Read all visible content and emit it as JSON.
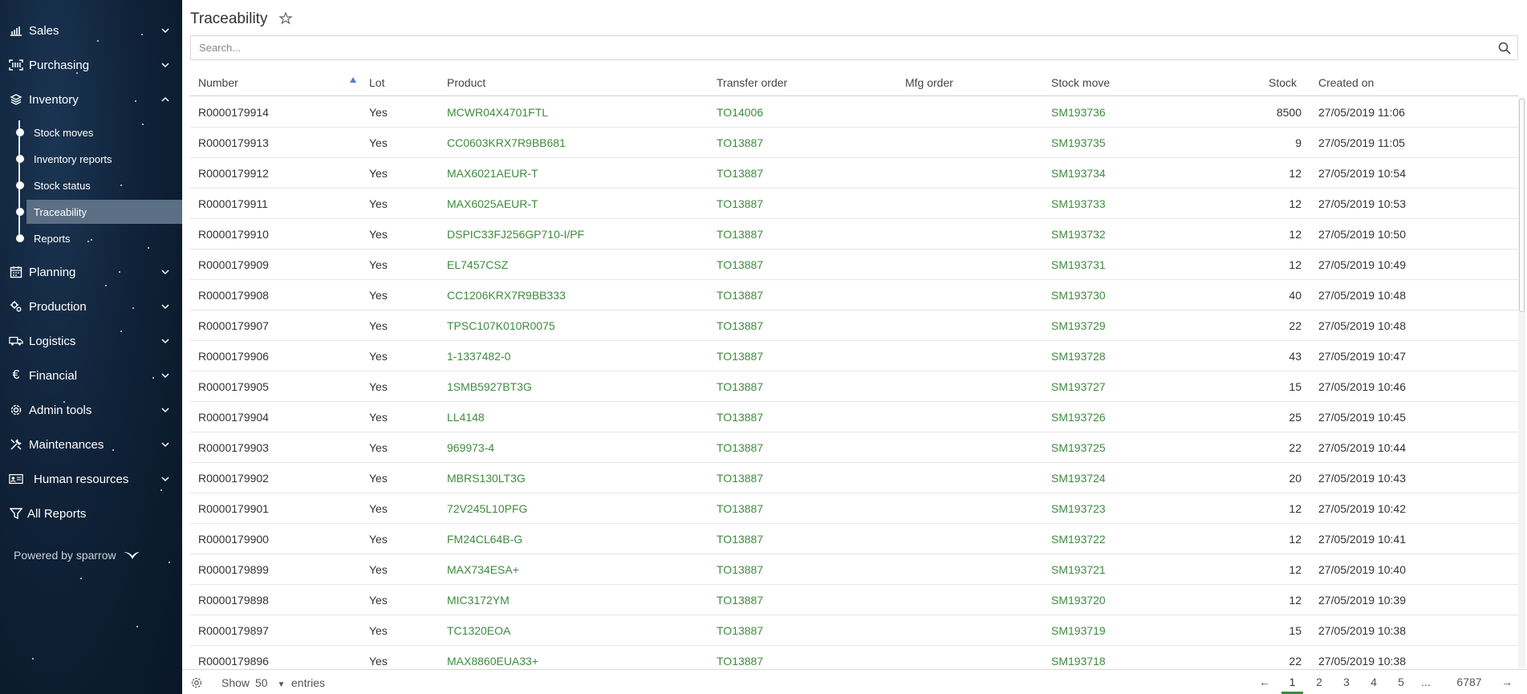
{
  "sidebar": {
    "items": [
      {
        "label": "Sales",
        "icon": "chart-icon",
        "expanded": false
      },
      {
        "label": "Purchasing",
        "icon": "scan-icon",
        "expanded": false
      },
      {
        "label": "Inventory",
        "icon": "layers-icon",
        "expanded": true
      },
      {
        "label": "Planning",
        "icon": "calendar-icon",
        "expanded": false
      },
      {
        "label": "Production",
        "icon": "cogs-icon",
        "expanded": false
      },
      {
        "label": "Logistics",
        "icon": "truck-icon",
        "expanded": false
      },
      {
        "label": "Financial",
        "icon": "euro-icon",
        "expanded": false
      },
      {
        "label": "Admin tools",
        "icon": "gear-icon",
        "expanded": false
      },
      {
        "label": "Maintenances",
        "icon": "tools-icon",
        "expanded": false
      },
      {
        "label": "Human resources",
        "icon": "id-card-icon",
        "expanded": false
      },
      {
        "label": "All Reports",
        "icon": "filter-icon"
      }
    ],
    "inventory_sub": [
      {
        "label": "Stock moves"
      },
      {
        "label": "Inventory reports"
      },
      {
        "label": "Stock status"
      },
      {
        "label": "Traceability",
        "active": true
      },
      {
        "label": "Reports"
      }
    ],
    "powered_by": "Powered by sparrow"
  },
  "page": {
    "title": "Traceability",
    "search_placeholder": "Search..."
  },
  "table": {
    "columns": [
      "Number",
      "Lot",
      "Product",
      "Transfer order",
      "Mfg order",
      "Stock move",
      "Stock",
      "Created on"
    ],
    "sort_column": "Number",
    "rows": [
      [
        "R0000179914",
        "Yes",
        "MCWR04X4701FTL",
        "TO14006",
        "",
        "SM193736",
        "8500",
        "27/05/2019 11:06"
      ],
      [
        "R0000179913",
        "Yes",
        "CC0603KRX7R9BB681",
        "TO13887",
        "",
        "SM193735",
        "9",
        "27/05/2019 11:05"
      ],
      [
        "R0000179912",
        "Yes",
        "MAX6021AEUR-T",
        "TO13887",
        "",
        "SM193734",
        "12",
        "27/05/2019 10:54"
      ],
      [
        "R0000179911",
        "Yes",
        "MAX6025AEUR-T",
        "TO13887",
        "",
        "SM193733",
        "12",
        "27/05/2019 10:53"
      ],
      [
        "R0000179910",
        "Yes",
        "DSPIC33FJ256GP710-I/PF",
        "TO13887",
        "",
        "SM193732",
        "12",
        "27/05/2019 10:50"
      ],
      [
        "R0000179909",
        "Yes",
        "EL7457CSZ",
        "TO13887",
        "",
        "SM193731",
        "12",
        "27/05/2019 10:49"
      ],
      [
        "R0000179908",
        "Yes",
        "CC1206KRX7R9BB333",
        "TO13887",
        "",
        "SM193730",
        "40",
        "27/05/2019 10:48"
      ],
      [
        "R0000179907",
        "Yes",
        "TPSC107K010R0075",
        "TO13887",
        "",
        "SM193729",
        "22",
        "27/05/2019 10:48"
      ],
      [
        "R0000179906",
        "Yes",
        "1-1337482-0",
        "TO13887",
        "",
        "SM193728",
        "43",
        "27/05/2019 10:47"
      ],
      [
        "R0000179905",
        "Yes",
        "1SMB5927BT3G",
        "TO13887",
        "",
        "SM193727",
        "15",
        "27/05/2019 10:46"
      ],
      [
        "R0000179904",
        "Yes",
        "LL4148",
        "TO13887",
        "",
        "SM193726",
        "25",
        "27/05/2019 10:45"
      ],
      [
        "R0000179903",
        "Yes",
        "969973-4",
        "TO13887",
        "",
        "SM193725",
        "22",
        "27/05/2019 10:44"
      ],
      [
        "R0000179902",
        "Yes",
        "MBRS130LT3G",
        "TO13887",
        "",
        "SM193724",
        "20",
        "27/05/2019 10:43"
      ],
      [
        "R0000179901",
        "Yes",
        "72V245L10PFG",
        "TO13887",
        "",
        "SM193723",
        "12",
        "27/05/2019 10:42"
      ],
      [
        "R0000179900",
        "Yes",
        "FM24CL64B-G",
        "TO13887",
        "",
        "SM193722",
        "12",
        "27/05/2019 10:41"
      ],
      [
        "R0000179899",
        "Yes",
        "MAX734ESA+",
        "TO13887",
        "",
        "SM193721",
        "12",
        "27/05/2019 10:40"
      ],
      [
        "R0000179898",
        "Yes",
        "MIC3172YM",
        "TO13887",
        "",
        "SM193720",
        "12",
        "27/05/2019 10:39"
      ],
      [
        "R0000179897",
        "Yes",
        "TC1320EOA",
        "TO13887",
        "",
        "SM193719",
        "15",
        "27/05/2019 10:38"
      ],
      [
        "R0000179896",
        "Yes",
        "MAX8860EUA33+",
        "TO13887",
        "",
        "SM193718",
        "22",
        "27/05/2019 10:38"
      ]
    ]
  },
  "footer": {
    "show_label": "Show",
    "page_size": "50",
    "entries_label": "entries",
    "prev": "←",
    "next": "→",
    "pages": [
      "1",
      "2",
      "3",
      "4",
      "5",
      "...",
      "6787"
    ],
    "current_page": "1"
  },
  "colors": {
    "link": "#3f8b3f",
    "sidebar_bg": "#0f2238",
    "active_sub_bg": "#5b6f84",
    "sort_arrow": "#5a78c8"
  }
}
